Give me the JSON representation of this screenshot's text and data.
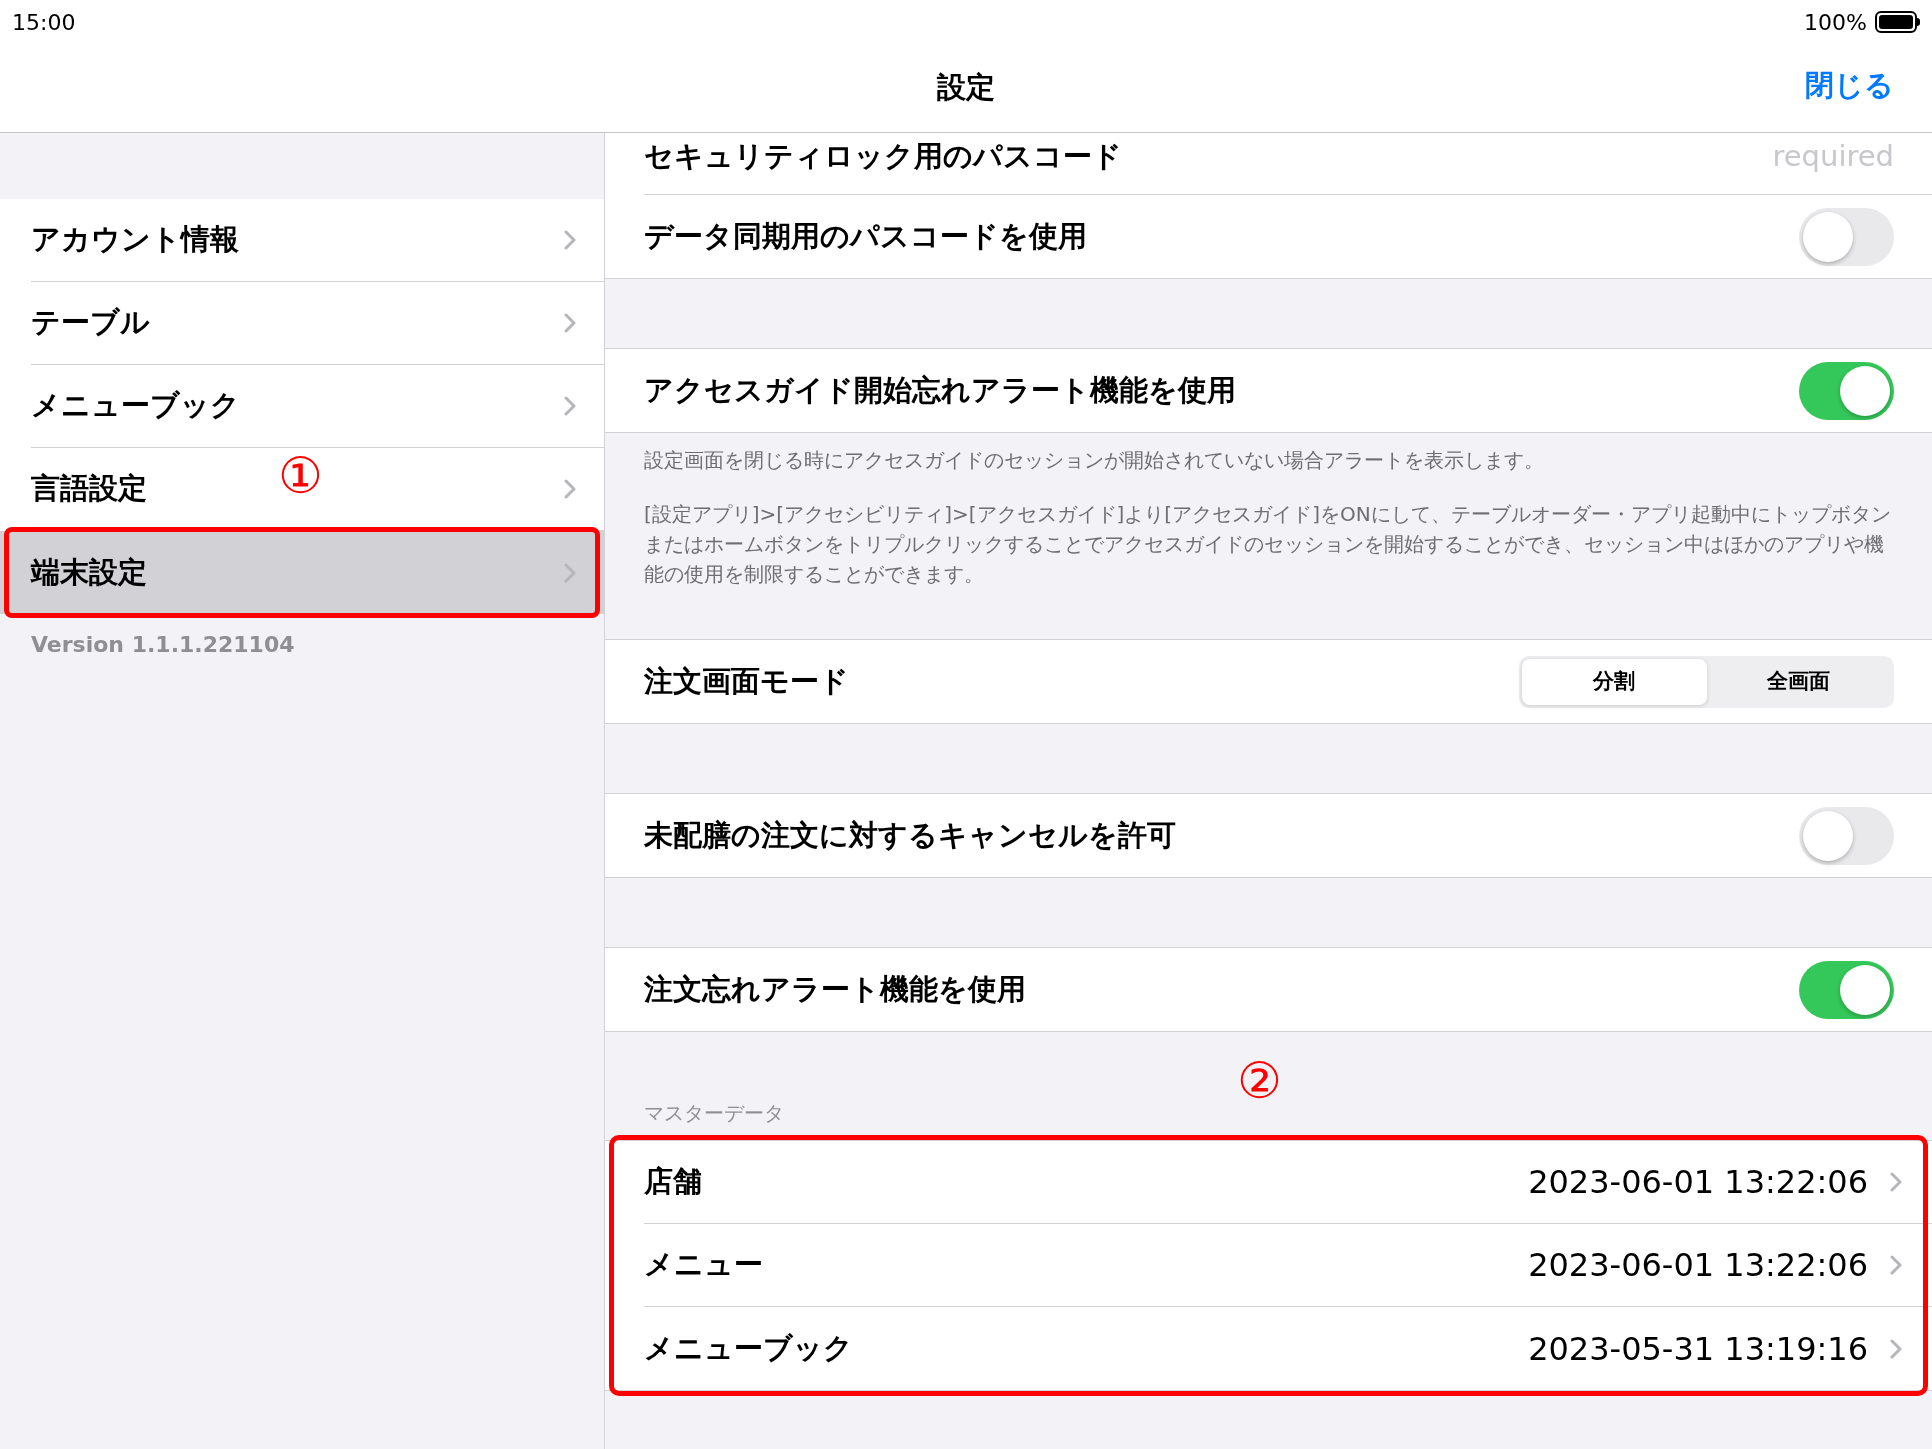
{
  "status_bar": {
    "time": "15:00",
    "battery": "100%"
  },
  "nav": {
    "title": "設定",
    "close_button": "閉じる"
  },
  "sidebar": {
    "items": [
      {
        "label": "アカウント情報",
        "selected": false,
        "highlighted": false
      },
      {
        "label": "テーブル",
        "selected": false,
        "highlighted": false
      },
      {
        "label": "メニューブック",
        "selected": false,
        "highlighted": false
      },
      {
        "label": "言語設定",
        "selected": false,
        "highlighted": false
      },
      {
        "label": "端末設定",
        "selected": true,
        "highlighted": true
      }
    ],
    "version": "Version 1.1.1.221104"
  },
  "annotations": [
    {
      "label": "①"
    },
    {
      "label": "②"
    }
  ],
  "groups": [
    {
      "highlighted": false,
      "rows": [
        {
          "kind": "value",
          "label": "セキュリティロック用のパスコード",
          "placeholder": "required"
        },
        {
          "kind": "toggle",
          "label": "データ同期用のパスコードを使用",
          "on": false
        }
      ]
    },
    {
      "highlighted": false,
      "rows": [
        {
          "kind": "toggle",
          "label": "アクセスガイド開始忘れアラート機能を使用",
          "on": true
        }
      ],
      "footer": [
        "設定画面を閉じる時にアクセスガイドのセッションが開始されていない場合アラートを表示します。",
        "[設定アプリ]>[アクセシビリティ]>[アクセスガイド]より[アクセスガイド]をONにして、テーブルオーダー・アプリ起動中にトップボタンまたはホームボタンをトリプルクリックすることでアクセスガイドのセッションを開始することができ、セッション中はほかのアプリや機能の使用を制限することができます。"
      ]
    },
    {
      "highlighted": false,
      "rows": [
        {
          "kind": "segmented",
          "label": "注文画面モード",
          "segments": [
            {
              "label": "分割",
              "selected": true
            },
            {
              "label": "全画面",
              "selected": false
            }
          ]
        }
      ]
    },
    {
      "highlighted": false,
      "rows": [
        {
          "kind": "toggle",
          "label": "未配膳の注文に対するキャンセルを許可",
          "on": false
        }
      ]
    },
    {
      "highlighted": false,
      "rows": [
        {
          "kind": "toggle",
          "label": "注文忘れアラート機能を使用",
          "on": true
        }
      ]
    },
    {
      "highlighted": true,
      "header": "マスターデータ",
      "rows": [
        {
          "kind": "detail",
          "label": "店舗",
          "value": "2023-06-01 13:22:06"
        },
        {
          "kind": "detail",
          "label": "メニュー",
          "value": "2023-06-01 13:22:06"
        },
        {
          "kind": "detail",
          "label": "メニューブック",
          "value": "2023-05-31 13:19:16"
        }
      ]
    }
  ]
}
